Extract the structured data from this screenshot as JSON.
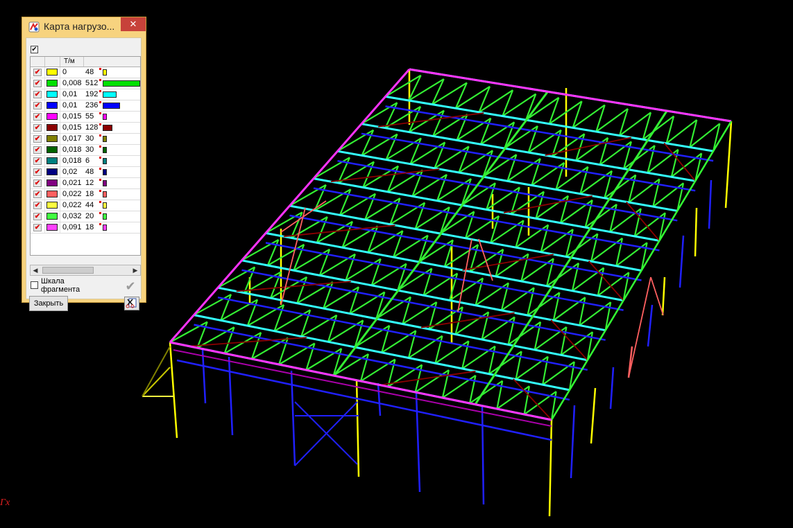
{
  "window": {
    "title": "Карта нагрузо...",
    "close_glyph": "✕",
    "app_icon": "app-logo-icon"
  },
  "legend": {
    "master_checked": true,
    "unit_header": "Т/м",
    "rows": [
      {
        "value": "0",
        "count": "48",
        "color": "#ffff00"
      },
      {
        "value": "0,008",
        "count": "512",
        "color": "#00e000"
      },
      {
        "value": "0,01",
        "count": "192",
        "color": "#00ffff"
      },
      {
        "value": "0,01",
        "count": "236",
        "color": "#0000ff"
      },
      {
        "value": "0,015",
        "count": "55",
        "color": "#ff00ff"
      },
      {
        "value": "0,015",
        "count": "128",
        "color": "#8b0000"
      },
      {
        "value": "0,017",
        "count": "30",
        "color": "#808000"
      },
      {
        "value": "0,018",
        "count": "30",
        "color": "#006400"
      },
      {
        "value": "0,018",
        "count": "6",
        "color": "#008080"
      },
      {
        "value": "0,02",
        "count": "48",
        "color": "#000080"
      },
      {
        "value": "0,021",
        "count": "12",
        "color": "#800080"
      },
      {
        "value": "0,022",
        "count": "18",
        "color": "#ff6060"
      },
      {
        "value": "0,022",
        "count": "44",
        "color": "#ffff40"
      },
      {
        "value": "0,032",
        "count": "20",
        "color": "#40ff40"
      },
      {
        "value": "0,091",
        "count": "18",
        "color": "#ff40ff"
      }
    ]
  },
  "controls": {
    "scale_label": "Шкала фрагмента",
    "scale_checked": false,
    "close_label": "Закрыть",
    "apply_icon": "checkmark-icon",
    "tool_icon": "scissors-icon"
  },
  "viewport": {
    "axis_label": "Гх",
    "background": "#000000"
  }
}
